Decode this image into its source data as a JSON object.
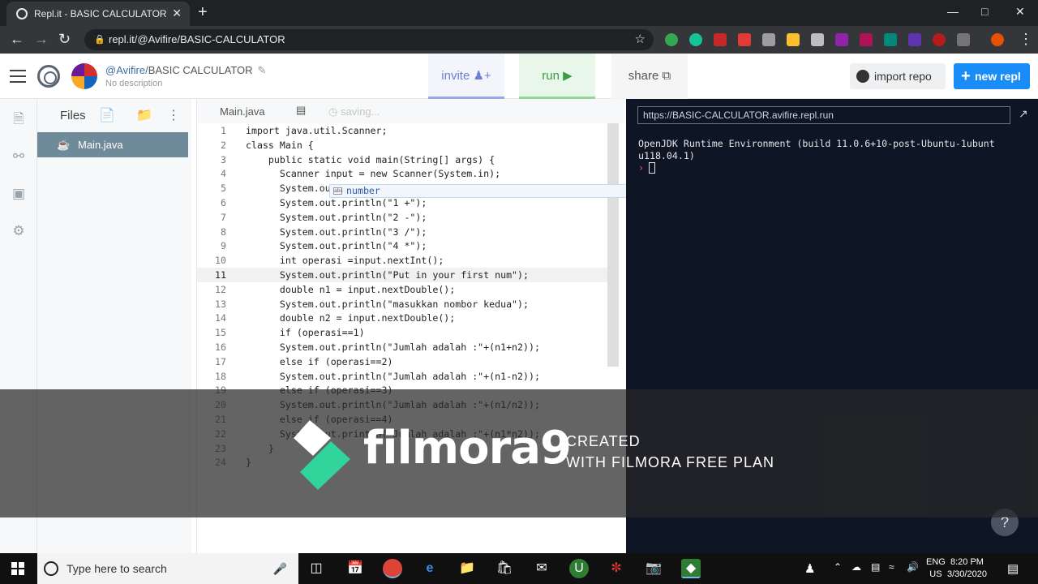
{
  "browser": {
    "tab_title": "Repl.it - BASIC CALCULATOR",
    "tab_close": "✕",
    "new_tab": "+",
    "url": "repl.it/@Avifire/BASIC-CALCULATOR"
  },
  "header": {
    "owner": "@Avifire/",
    "repl_name": "BASIC CALCULATOR",
    "description": "No description",
    "invite_label": "invite",
    "run_label": "run",
    "share_label": "share",
    "import_label": "import repo",
    "new_repl_label": "new repl"
  },
  "files": {
    "title": "Files",
    "items": [
      {
        "name": "Main.java"
      }
    ]
  },
  "editor": {
    "tab": "Main.java",
    "status": "saving...",
    "active_line": 11,
    "lines": [
      {
        "n": "1",
        "code": "import java.util.Scanner;"
      },
      {
        "n": "2",
        "code": "class Main {"
      },
      {
        "n": "3",
        "code": "    public static void main(String[] args) {"
      },
      {
        "n": "4",
        "code": "      Scanner input = new Scanner(System.in);"
      },
      {
        "n": "5",
        "code": "      System.out.println(\"Choose your operation number\");"
      },
      {
        "n": "6",
        "code": "      System.out.println(\"1 +\");"
      },
      {
        "n": "7",
        "code": "      System.out.println(\"2 -\");"
      },
      {
        "n": "8",
        "code": "      System.out.println(\"3 /\");"
      },
      {
        "n": "9",
        "code": "      System.out.println(\"4 *\");"
      },
      {
        "n": "10",
        "code": "      int operasi =input.nextInt();"
      },
      {
        "n": "11",
        "code": "      System.out.println(\"Put in your first num\");"
      },
      {
        "n": "12",
        "code": "      double n1 = input.nextDouble();"
      },
      {
        "n": "13",
        "code": "      System.out.println(\"masukkan nombor kedua\");"
      },
      {
        "n": "14",
        "code": "      double n2 = input.nextDouble();"
      },
      {
        "n": "15",
        "code": "      if (operasi==1)"
      },
      {
        "n": "16",
        "code": "      System.out.println(\"Jumlah adalah :\"+(n1+n2));"
      },
      {
        "n": "17",
        "code": "      else if (operasi==2)"
      },
      {
        "n": "18",
        "code": "      System.out.println(\"Jumlah adalah :\"+(n1-n2));"
      },
      {
        "n": "19",
        "code": "      else if (operasi==3)"
      },
      {
        "n": "20",
        "code": "      System.out.println(\"Jumlah adalah :\"+(n1/n2));"
      },
      {
        "n": "21",
        "code": "      else if (operasi==4)"
      },
      {
        "n": "22",
        "code": "      System.out.println(\"Jumlah adalah :\"+(n1*n2));"
      },
      {
        "n": "23",
        "code": "    }"
      },
      {
        "n": "24",
        "code": "}"
      }
    ],
    "suggestion": "number",
    "suggestion_icon": "abc"
  },
  "console": {
    "url": "https://BASIC-CALCULATOR.avifire.repl.run",
    "output": "OpenJDK Runtime Environment (build 11.0.6+10-post-Ubuntu-1ubunt\nu118.04.1)",
    "prompt": "›",
    "help": "?"
  },
  "watermark": {
    "brand": "filmora9",
    "line1": "CREATED",
    "line2": "WITH FILMORA FREE PLAN"
  },
  "taskbar": {
    "search_placeholder": "Type here to search",
    "lang1": "ENG",
    "lang2": "US",
    "time": "8:20 PM",
    "date": "3/30/2020"
  },
  "colors": {
    "accent_run": "#3c9a45",
    "accent_invite": "#6b7fd7",
    "new_repl_bg": "#1a8cf7",
    "console_bg": "#0e1525"
  }
}
